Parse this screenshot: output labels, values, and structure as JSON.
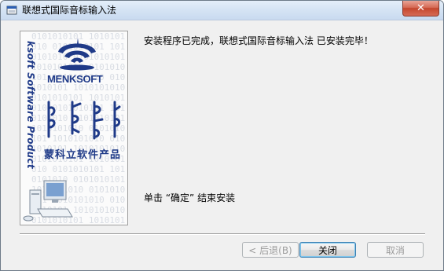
{
  "window": {
    "title": "联想式国际音标输入法",
    "close_glyph": "✕"
  },
  "banner": {
    "slogan": "ksoft Software Product",
    "brand": "MENKSOFT",
    "product_cn": "蒙科立软件产品",
    "binary_pattern": "0101010101 1010101010 0101010101 1010101010 0101010101 1010101010 0101010101 1010101010 0101010101 1010101010 0101010101 1010101010 0101010101 1010101010 0101010101 1010101010 0101010101 1010101010 0101010101 1010101010 0101010101 1010101010 0101010101 1010101010 0101010101 1010101010 0101010101 1010101010 0101010101 1010101010 0101010101 1010101010 0101010101 1010101010 0101010101 1010101010 0101010101 1010101010 0101010101 1010101010 0101010101 1010101010 0101010101 1010101010 0101010101 1010101010"
  },
  "content": {
    "message": "安装程序已完成，联想式国际音标输入法 已安装完毕！",
    "instruction": "单击 “确定” 结束安装"
  },
  "buttons": {
    "back": "< 后退(B)",
    "close": "关闭",
    "cancel": "取消"
  },
  "icons": {
    "title": "installer-icon",
    "close": "close-icon"
  },
  "colors": {
    "brand_blue": "#1f3a88",
    "close_red": "#c4472e"
  }
}
